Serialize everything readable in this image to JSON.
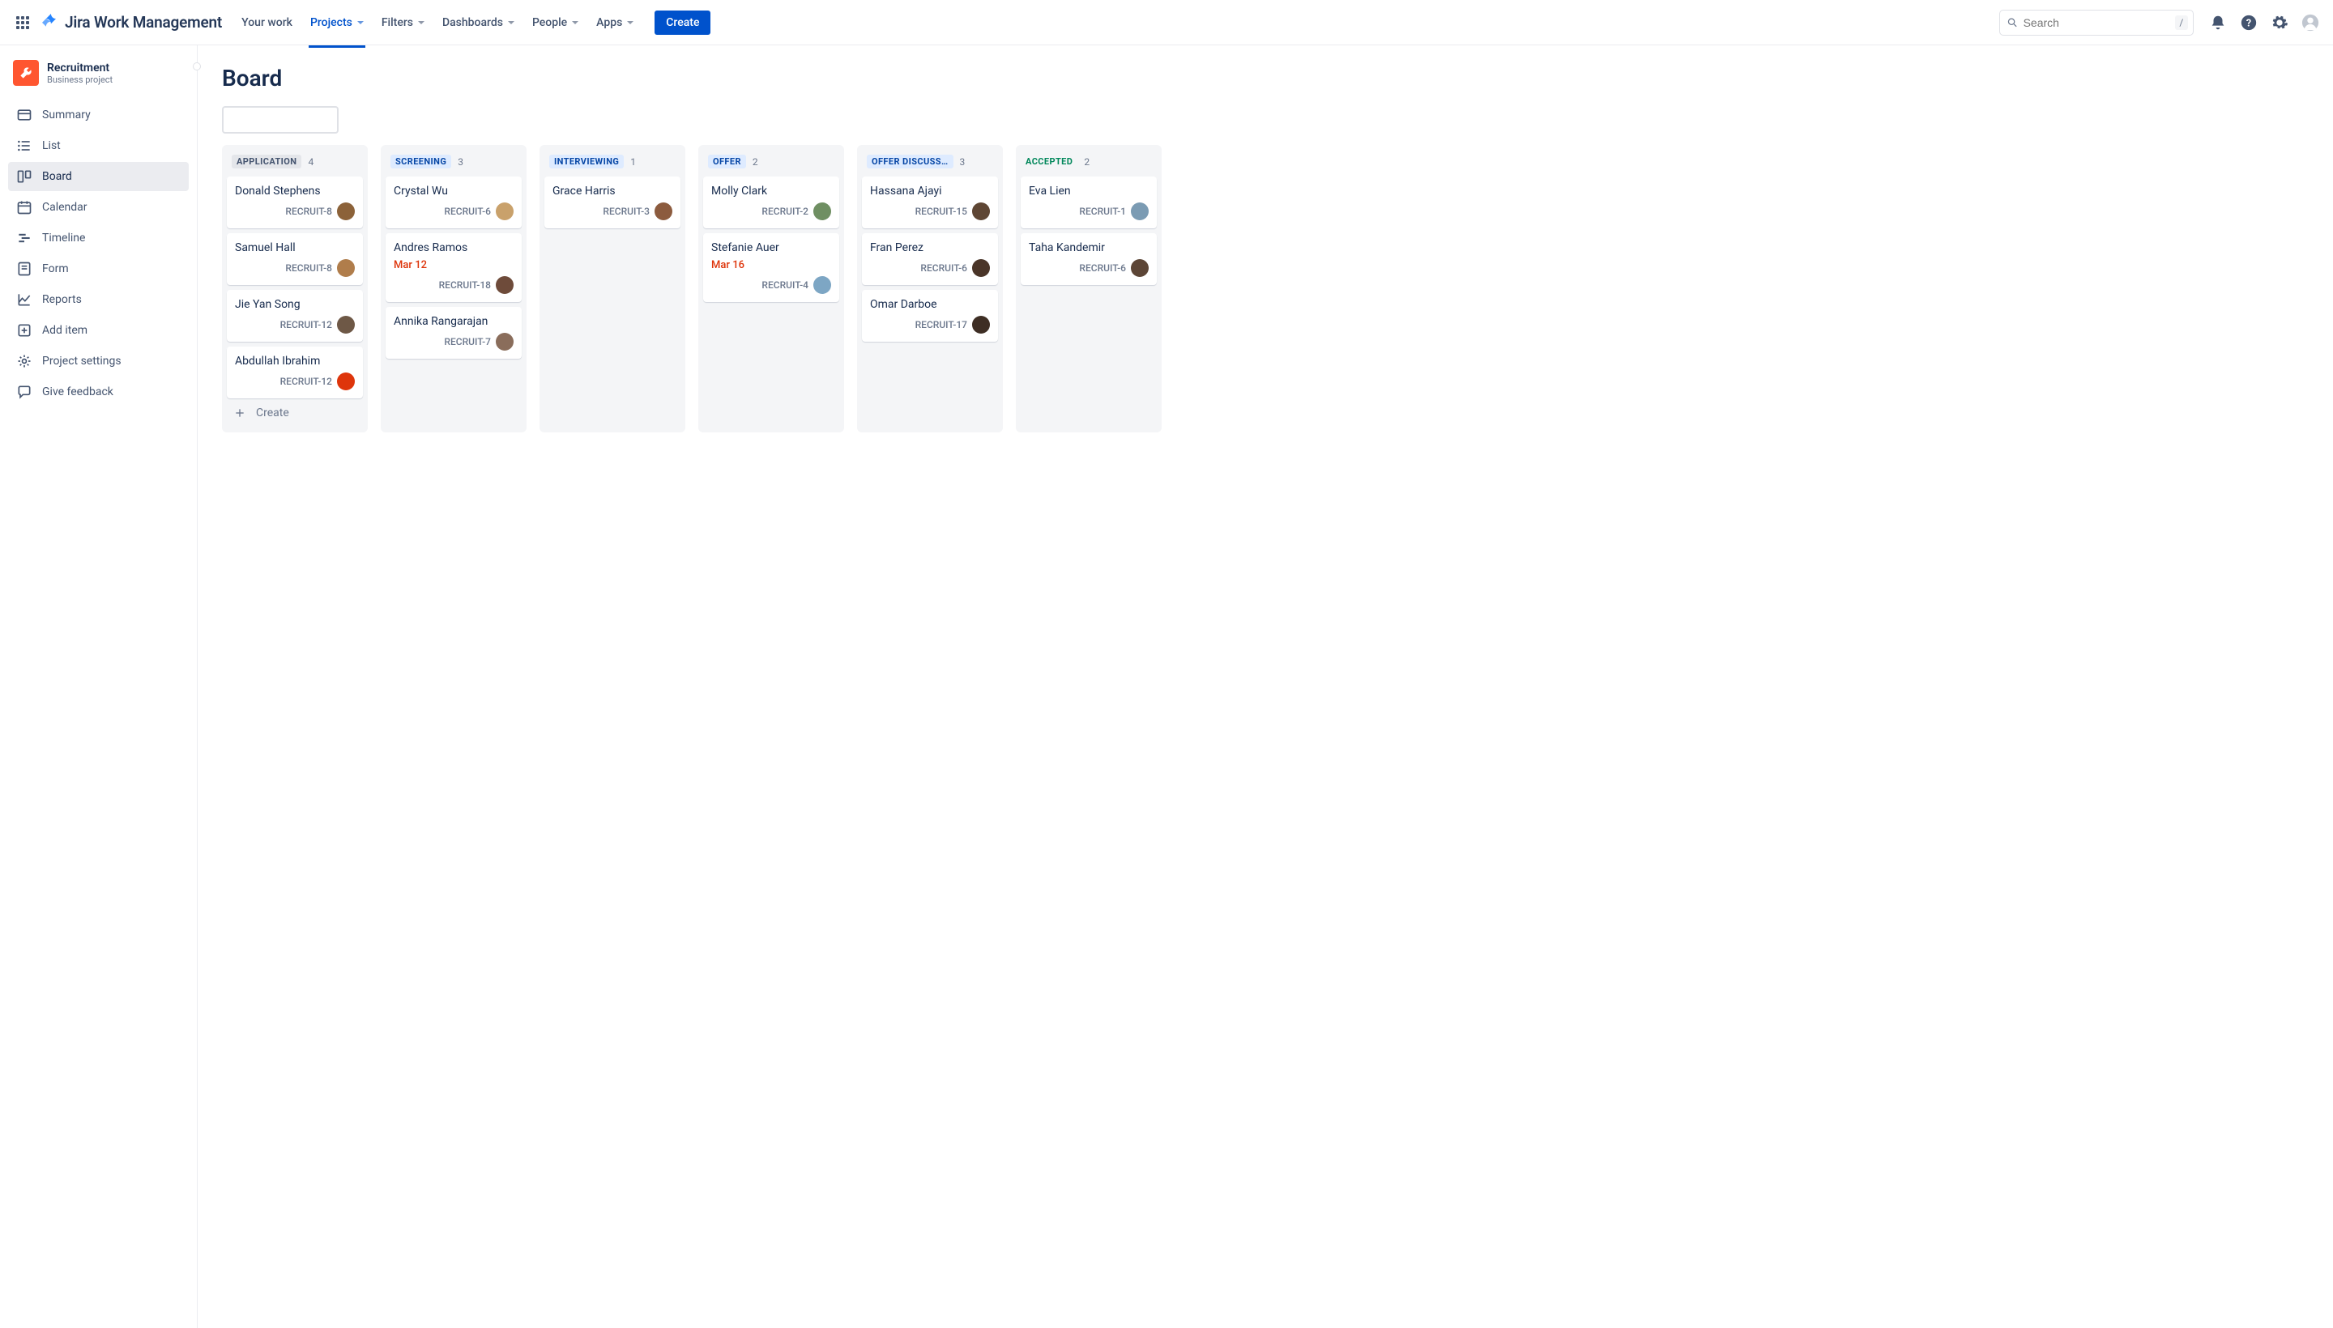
{
  "topnav": {
    "logo_text": "Jira Work Management",
    "items": [
      {
        "label": "Your work",
        "active": false,
        "has_caret": false
      },
      {
        "label": "Projects",
        "active": true,
        "has_caret": true
      },
      {
        "label": "Filters",
        "active": false,
        "has_caret": true
      },
      {
        "label": "Dashboards",
        "active": false,
        "has_caret": true
      },
      {
        "label": "People",
        "active": false,
        "has_caret": true
      },
      {
        "label": "Apps",
        "active": false,
        "has_caret": true
      }
    ],
    "create_label": "Create",
    "search_placeholder": "Search",
    "slash_hint": "/"
  },
  "sidebar": {
    "project_name": "Recruitment",
    "project_type": "Business project",
    "links": [
      {
        "label": "Summary"
      },
      {
        "label": "List"
      },
      {
        "label": "Board",
        "active": true
      },
      {
        "label": "Calendar"
      },
      {
        "label": "Timeline"
      },
      {
        "label": "Form"
      },
      {
        "label": "Reports"
      },
      {
        "label": "Add item"
      },
      {
        "label": "Project settings"
      },
      {
        "label": "Give feedback"
      }
    ]
  },
  "board": {
    "title": "Board",
    "create_label": "Create",
    "columns": [
      {
        "title": "APPLICATION",
        "count": "4",
        "style": "c-gray",
        "show_create": true,
        "cards": [
          {
            "title": "Donald Stephens",
            "key": "RECRUIT-8",
            "avatar": "#8C6239"
          },
          {
            "title": "Samuel Hall",
            "key": "RECRUIT-8",
            "avatar": "#B07D4B"
          },
          {
            "title": "Jie Yan Song",
            "key": "RECRUIT-12",
            "avatar": "#6E5846"
          },
          {
            "title": "Abdullah Ibrahim",
            "key": "RECRUIT-12",
            "avatar": "#DE350B"
          }
        ]
      },
      {
        "title": "SCREENING",
        "count": "3",
        "style": "c-blue",
        "cards": [
          {
            "title": "Crystal Wu",
            "key": "RECRUIT-6",
            "avatar": "#C9A16B"
          },
          {
            "title": "Andres Ramos",
            "key": "RECRUIT-18",
            "date": "Mar 12",
            "avatar": "#6E4B3A"
          },
          {
            "title": "Annika Rangarajan",
            "key": "RECRUIT-7",
            "avatar": "#8A6D5B"
          }
        ]
      },
      {
        "title": "INTERVIEWING",
        "count": "1",
        "style": "c-blue",
        "cards": [
          {
            "title": "Grace Harris",
            "key": "RECRUIT-3",
            "avatar": "#8C5B3E"
          }
        ]
      },
      {
        "title": "OFFER",
        "count": "2",
        "style": "c-blue",
        "cards": [
          {
            "title": "Molly Clark",
            "key": "RECRUIT-2",
            "avatar": "#6F8F62"
          },
          {
            "title": "Stefanie Auer",
            "key": "RECRUIT-4",
            "date": "Mar 16",
            "avatar": "#7DA6C4"
          }
        ]
      },
      {
        "title": "OFFER DISCUSS…",
        "count": "3",
        "style": "c-blue",
        "cards": [
          {
            "title": "Hassana Ajayi",
            "key": "RECRUIT-15",
            "avatar": "#5E4634"
          },
          {
            "title": "Fran Perez",
            "key": "RECRUIT-6",
            "avatar": "#4A3528"
          },
          {
            "title": "Omar Darboe",
            "key": "RECRUIT-17",
            "avatar": "#3E2E24"
          }
        ]
      },
      {
        "title": "ACCEPTED",
        "count": "2",
        "style": "c-green",
        "cards": [
          {
            "title": "Eva Lien",
            "key": "RECRUIT-1",
            "avatar": "#7B9BB3"
          },
          {
            "title": "Taha Kandemir",
            "key": "RECRUIT-6",
            "avatar": "#5C4536"
          }
        ]
      }
    ]
  }
}
